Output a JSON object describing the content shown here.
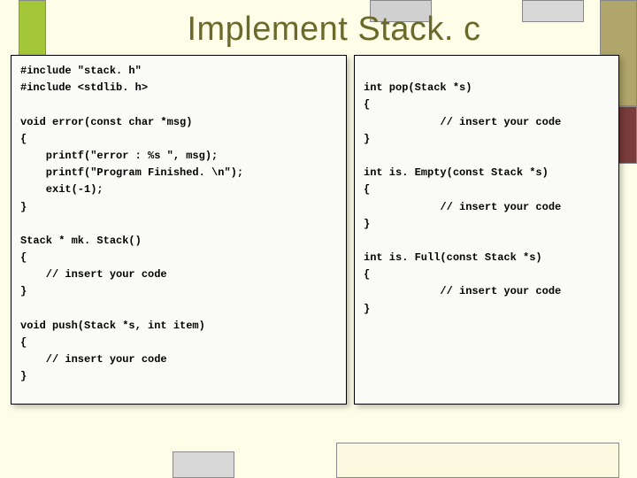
{
  "title": "Implement Stack. c",
  "code_left": "#include \"stack. h\"\n#include <stdlib. h>\n\nvoid error(const char *msg)\n{\n    printf(\"error : %s \", msg);\n    printf(\"Program Finished. \\n\");\n    exit(-1);\n}\n\nStack * mk. Stack()\n{\n    // insert your code\n}\n\nvoid push(Stack *s, int item)\n{\n    // insert your code\n}",
  "code_right": "\nint pop(Stack *s)\n{\n            // insert your code\n}\n\nint is. Empty(const Stack *s)\n{\n            // insert your code\n}\n\nint is. Full(const Stack *s)\n{\n            // insert your code\n}"
}
